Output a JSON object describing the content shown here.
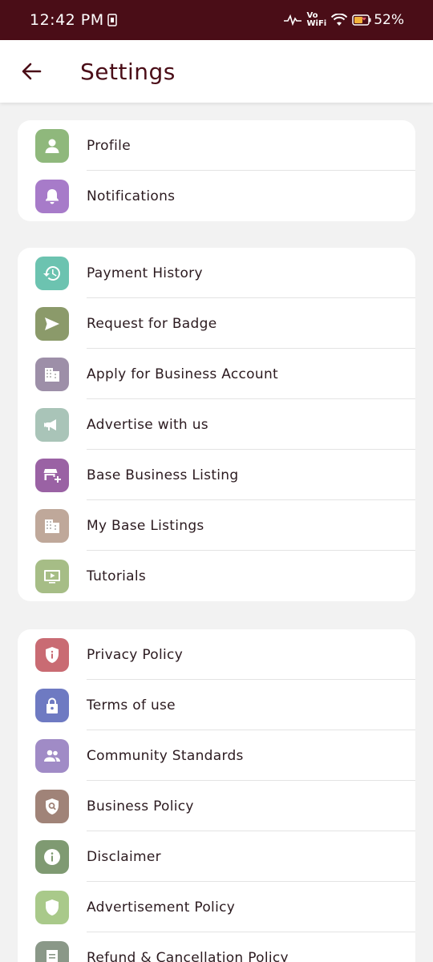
{
  "status_bar": {
    "time": "12:42 PM",
    "vowifi_top": "Vo",
    "vowifi_bottom": "WiFi",
    "battery": "52%"
  },
  "header": {
    "title": "Settings"
  },
  "groups": [
    {
      "items": [
        {
          "label": "Profile",
          "icon": "person-icon",
          "color": "#8fb87c"
        },
        {
          "label": "Notifications",
          "icon": "bell-icon",
          "color": "#a77bc9"
        }
      ]
    },
    {
      "items": [
        {
          "label": "Payment History",
          "icon": "history-icon",
          "color": "#6cc3b0"
        },
        {
          "label": "Request for Badge",
          "icon": "send-icon",
          "color": "#8b9a6a"
        },
        {
          "label": "Apply for Business Account",
          "icon": "building-icon",
          "color": "#9d8fa8"
        },
        {
          "label": "Advertise with us",
          "icon": "megaphone-icon",
          "color": "#a9c4b8"
        },
        {
          "label": "Base Business Listing",
          "icon": "store-add-icon",
          "color": "#9a62a4"
        },
        {
          "label": "My Base Listings",
          "icon": "building-icon",
          "color": "#bfa89a"
        },
        {
          "label": "Tutorials",
          "icon": "video-icon",
          "color": "#a6bd86"
        }
      ]
    },
    {
      "items": [
        {
          "label": "Privacy Policy",
          "icon": "shield-info-icon",
          "color": "#c96b73"
        },
        {
          "label": "Terms of use",
          "icon": "lock-icon",
          "color": "#6e7ac2"
        },
        {
          "label": "Community Standards",
          "icon": "people-icon",
          "color": "#a08bc6"
        },
        {
          "label": "Business Policy",
          "icon": "shield-search-icon",
          "color": "#a08378"
        },
        {
          "label": "Disclaimer",
          "icon": "info-icon",
          "color": "#7f9a72"
        },
        {
          "label": "Advertisement Policy",
          "icon": "shield-check-icon",
          "color": "#a9c98a"
        },
        {
          "label": "Refund & Cancellation Policy",
          "icon": "receipt-icon",
          "color": "#8a9888"
        }
      ]
    }
  ]
}
